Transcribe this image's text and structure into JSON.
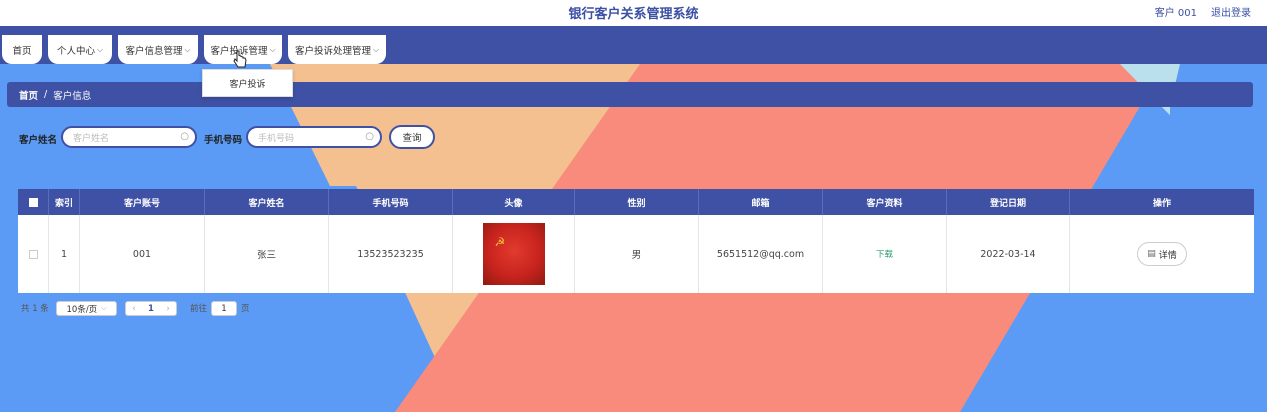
{
  "header": {
    "title": "银行客户关系管理系统",
    "user": "客户 001",
    "logout": "退出登录"
  },
  "nav": {
    "items": [
      {
        "label": "首页",
        "has_chevron": false
      },
      {
        "label": "个人中心",
        "has_chevron": true
      },
      {
        "label": "客户信息管理",
        "has_chevron": true
      },
      {
        "label": "客户投诉管理",
        "has_chevron": true
      },
      {
        "label": "客户投诉处理管理",
        "has_chevron": true
      }
    ],
    "dropdown_item": "客户投诉"
  },
  "breadcrumb": {
    "home": "首页",
    "sep": "/",
    "current": "客户信息"
  },
  "search": {
    "name_label": "客户姓名",
    "name_placeholder": "客户姓名",
    "phone_label": "手机号码",
    "phone_placeholder": "手机号码",
    "button": "查询"
  },
  "table": {
    "headers": [
      "索引",
      "客户账号",
      "客户姓名",
      "手机号码",
      "头像",
      "性别",
      "邮箱",
      "客户资料",
      "登记日期",
      "操作"
    ],
    "rows": [
      {
        "index": "1",
        "account": "001",
        "name": "张三",
        "phone": "13523523235",
        "gender": "男",
        "email": "5651512@qq.com",
        "file": "下载",
        "date": "2022-03-14",
        "action": "详情"
      }
    ]
  },
  "pagination": {
    "total": "共 1 条",
    "page_size": "10条/页",
    "current_page": "1",
    "goto_label": "前往",
    "goto_value": "1",
    "page_suffix": "页"
  },
  "colors": {
    "primary": "#3f51a5",
    "background": "#5b9bf5",
    "peach": "#f5c08f",
    "salmon": "#f88b7c"
  },
  "icons": [
    "search-icon",
    "chevron-down-icon",
    "chevron-left-icon",
    "chevron-right-icon",
    "document-icon",
    "cursor-icon"
  ]
}
